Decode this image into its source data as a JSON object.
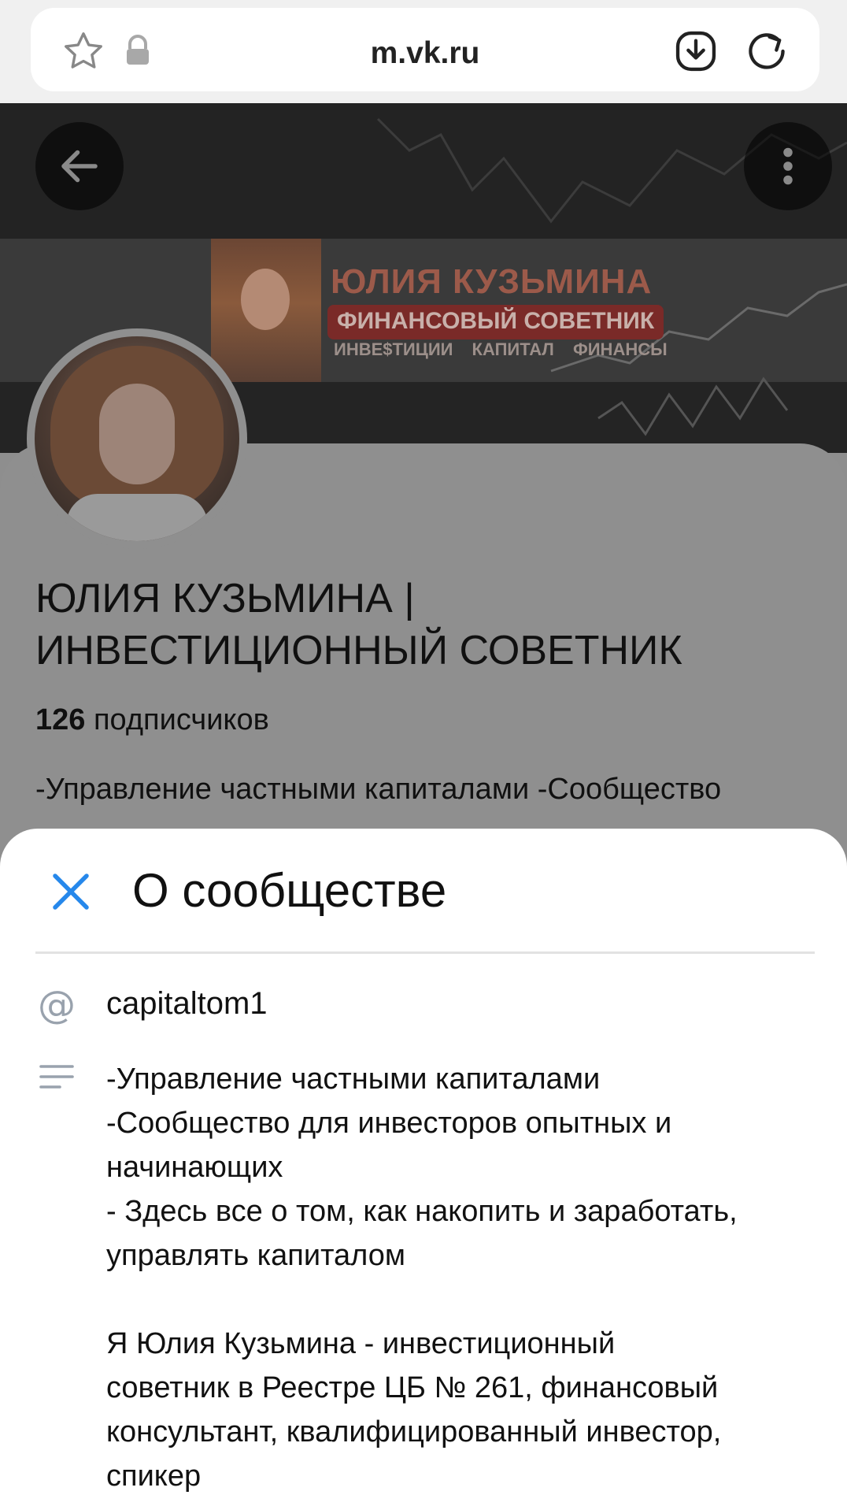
{
  "browser": {
    "url": "m.vk.ru",
    "icons": [
      "star-icon",
      "lock-icon",
      "download-icon",
      "reload-icon"
    ]
  },
  "cover": {
    "banner_title": "ЮЛИЯ КУЗЬМИНА",
    "banner_subtitle": "ФИНАНСОВЫЙ СОВЕТНИК",
    "banner_tags": "ИНВЕ$ТИЦИИ КАПИТАЛ ФИНАНСЫ"
  },
  "group": {
    "name_line1": "ЮЛИЯ КУЗЬМИНА |",
    "name_line2": "ИНВЕСТИЦИОННЫЙ СОВЕТНИК",
    "subscribers_count": "126",
    "subscribers_label": " подписчиков",
    "description_preview": "-Управление частными капиталами -Сообщество"
  },
  "sheet": {
    "title": "О сообществе",
    "handle": "capitaltom1",
    "description_lines": [
      "-Управление частными капиталами",
      "-Сообщество для инвесторов опытных и",
      "начинающих",
      "- Здесь все о том, как накопить и заработать,",
      "управлять капиталом",
      "",
      "Я Юлия Кузьмина - инвестиционный",
      "советник в Реестре ЦБ № 261, финансовый",
      "консультант, квалифицированный инвестор,",
      "спикер"
    ]
  },
  "colors": {
    "accent": "#2688eb",
    "icon_gray": "#99a2ad",
    "overlay_gray": "#8f8f8f"
  }
}
